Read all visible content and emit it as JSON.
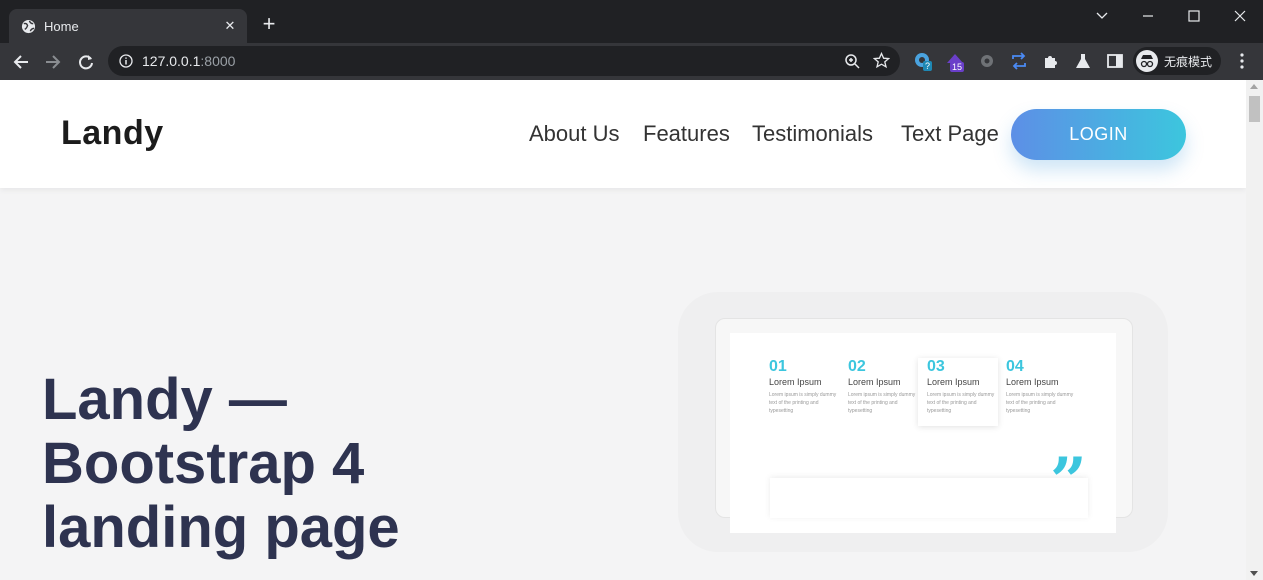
{
  "browser": {
    "tab": {
      "title": "Home",
      "close": "✕"
    },
    "new_tab": "+",
    "url": {
      "host": "127.0.0.1",
      "port": ":8000"
    },
    "extensions": {
      "badge1": "?",
      "badge2": "15"
    },
    "profile_label": "无痕模式"
  },
  "site": {
    "logo": "Landy",
    "nav": {
      "about": "About Us",
      "features": "Features",
      "testimonials": "Testimonials",
      "text_page": "Text Page"
    },
    "login": "LOGIN",
    "hero": {
      "title": "Landy — Bootstrap 4 landing page"
    },
    "mockup": {
      "steps": [
        {
          "num": "01",
          "label": "Lorem Ipsum",
          "text": "Lorem ipsum is simply dummy text of the printing and typesetting"
        },
        {
          "num": "02",
          "label": "Lorem Ipsum",
          "text": "Lorem ipsum is simply dummy text of the printing and typesetting"
        },
        {
          "num": "03",
          "label": "Lorem Ipsum",
          "text": "Lorem ipsum is simply dummy text of the printing and typesetting"
        },
        {
          "num": "04",
          "label": "Lorem Ipsum",
          "text": "Lorem ipsum is simply dummy text of the printing and typesetting"
        }
      ],
      "quote_mark": "”"
    }
  },
  "colors": {
    "accent_start": "#5d8fe6",
    "accent_end": "#3cc6de",
    "hero_text": "#2e3350"
  }
}
